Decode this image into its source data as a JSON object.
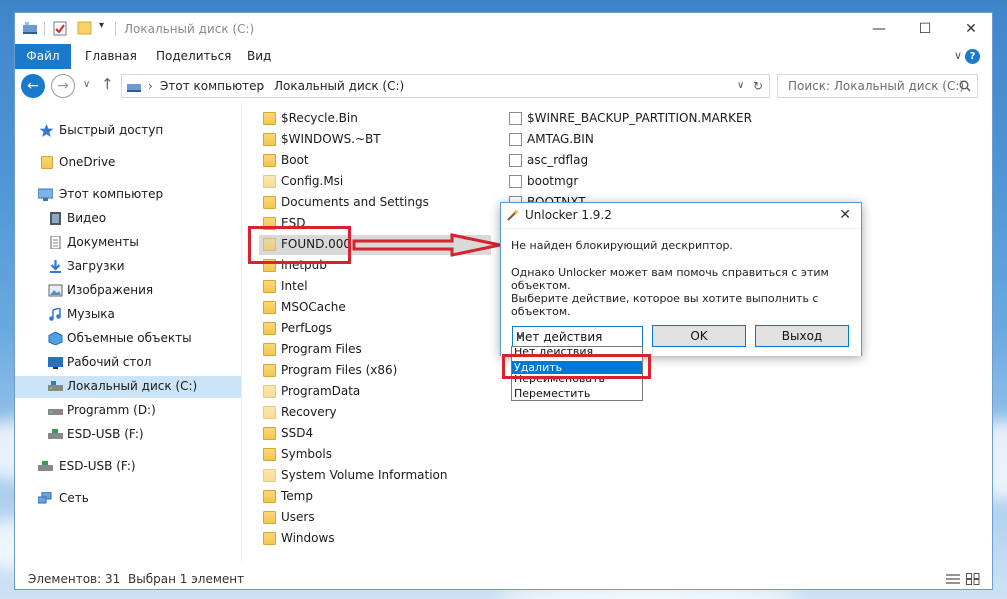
{
  "window": {
    "title": "Локальный диск (C:)",
    "controls": [
      "minimize",
      "maximize",
      "close"
    ]
  },
  "ribbon": {
    "tabs": [
      "Файл",
      "Главная",
      "Поделиться",
      "Вид"
    ],
    "help": "?"
  },
  "address": {
    "segments": [
      "Этот компьютер",
      "Локальный диск (C:)"
    ],
    "search_placeholder": "Поиск: Локальный диск (C:)"
  },
  "sidebar": {
    "items": [
      {
        "label": "Быстрый доступ",
        "icon": "star-icon"
      },
      {
        "label": "OneDrive",
        "icon": "folder-icon"
      },
      {
        "label": "Этот компьютер",
        "icon": "computer-icon"
      },
      {
        "label": "Видео",
        "icon": "video-icon"
      },
      {
        "label": "Документы",
        "icon": "documents-icon"
      },
      {
        "label": "Загрузки",
        "icon": "download-icon"
      },
      {
        "label": "Изображения",
        "icon": "pictures-icon"
      },
      {
        "label": "Музыка",
        "icon": "music-icon"
      },
      {
        "label": "Объемные объекты",
        "icon": "3d-objects-icon"
      },
      {
        "label": "Рабочий стол",
        "icon": "desktop-icon"
      },
      {
        "label": "Локальный диск (C:)",
        "icon": "drive-icon"
      },
      {
        "label": "Programm (D:)",
        "icon": "drive-icon"
      },
      {
        "label": "ESD-USB (F:)",
        "icon": "usb-drive-icon"
      },
      {
        "label": "ESD-USB (F:)",
        "icon": "usb-drive-icon"
      },
      {
        "label": "Сеть",
        "icon": "network-icon"
      }
    ]
  },
  "files": {
    "col1": [
      "$Recycle.Bin",
      "$WINDOWS.~BT",
      "Boot",
      "Config.Msi",
      "Documents and Settings",
      "ESD",
      "FOUND.000",
      "inetpub",
      "Intel",
      "MSOCache",
      "PerfLogs",
      "Program Files",
      "Program Files (x86)",
      "ProgramData",
      "Recovery",
      "SSD4",
      "Symbols",
      "System Volume Information",
      "Temp",
      "Users",
      "Windows"
    ],
    "col2": [
      "$WINRE_BACKUP_PARTITION.MARKER",
      "AMTAG.BIN",
      "asc_rdflag",
      "bootmgr",
      "BOOTNXT"
    ]
  },
  "status": {
    "count": "Элементов: 31",
    "selected": "Выбран 1 элемент"
  },
  "dialog": {
    "title": "Unlocker 1.9.2",
    "line1": "Не найден блокирующий дескриптор.",
    "line2": "Однако Unlocker может вам помочь справиться с этим объектом.",
    "line3": "Выберите действие, которое вы хотите выполнить с объектом.",
    "combo_value": "Нет действия",
    "ok": "OK",
    "exit": "Выход",
    "options": [
      "Нет действия",
      "Удалить",
      "Переименовать",
      "Переместить"
    ]
  },
  "colors": {
    "accent": "#1979ca",
    "annotation": "#d6232d",
    "selection": "#cce4f7"
  }
}
